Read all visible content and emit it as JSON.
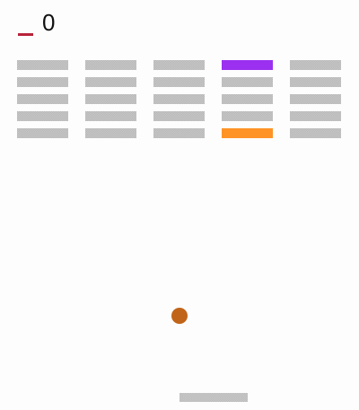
{
  "hud": {
    "score": "0",
    "lives_indicator_color": "#b8233a"
  },
  "bricks": {
    "rows": 5,
    "columns": 5,
    "default_color": "#b9b9b9",
    "grid": [
      [
        "gray",
        "gray",
        "gray",
        "purple",
        "gray"
      ],
      [
        "gray",
        "gray",
        "gray",
        "gray",
        "gray"
      ],
      [
        "gray",
        "gray",
        "gray",
        "gray",
        "gray"
      ],
      [
        "gray",
        "gray",
        "gray",
        "gray",
        "gray"
      ],
      [
        "gray",
        "gray",
        "gray",
        "orange",
        "gray"
      ]
    ],
    "special_colors": {
      "purple": "#9b30f0",
      "orange": "#ff9326"
    }
  },
  "ball": {
    "color": "#c0641a"
  },
  "paddle": {
    "color": "#bcbcbc"
  }
}
